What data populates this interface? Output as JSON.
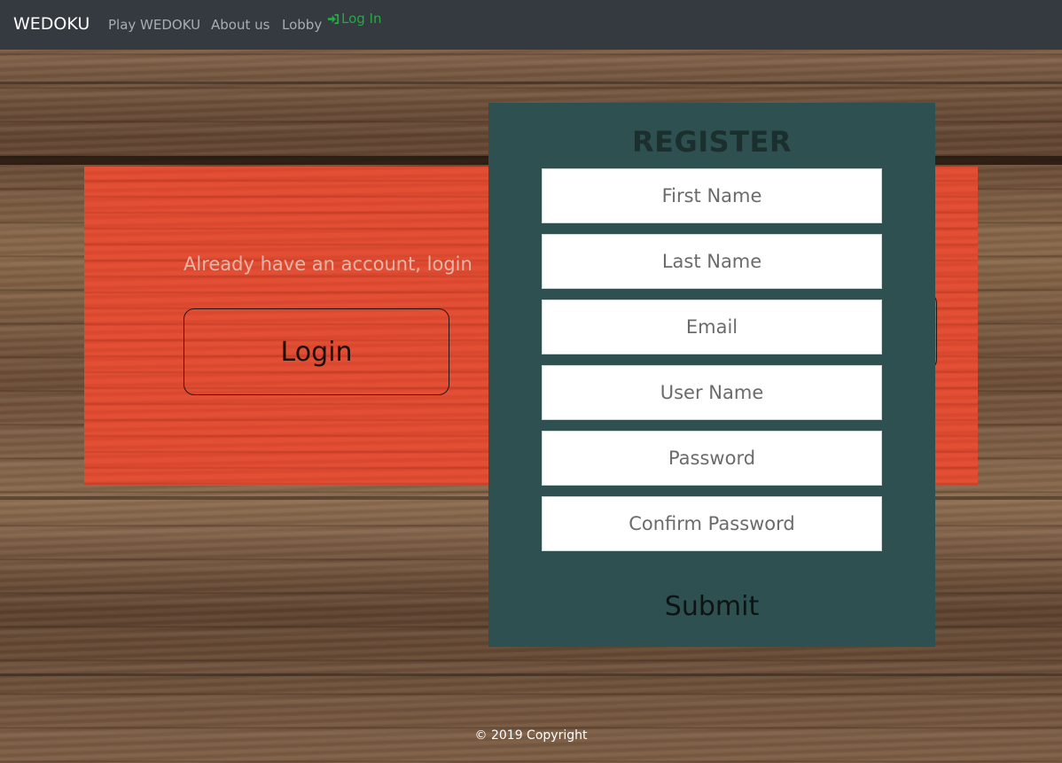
{
  "navbar": {
    "brand": "WEDOKU",
    "links": [
      "Play WEDOKU",
      "About us",
      "Lobby"
    ],
    "login_label": "Log In",
    "login_icon": "sign-in-icon",
    "login_color": "#28a745"
  },
  "login_panel": {
    "prompt": "Already have an account, login",
    "button_label": "Login"
  },
  "register": {
    "title": "REGISTER",
    "fields": {
      "first_name": "First Name",
      "last_name": "Last Name",
      "email": "Email",
      "user_name": "User Name",
      "password": "Password",
      "confirm_password": "Confirm Password"
    },
    "submit_label": "Submit"
  },
  "footer": {
    "copyright": "© 2019 Copyright"
  },
  "colors": {
    "navbar_bg": "#343a40",
    "panel_red": "#e04a30",
    "card_bg": "#2e5050"
  }
}
